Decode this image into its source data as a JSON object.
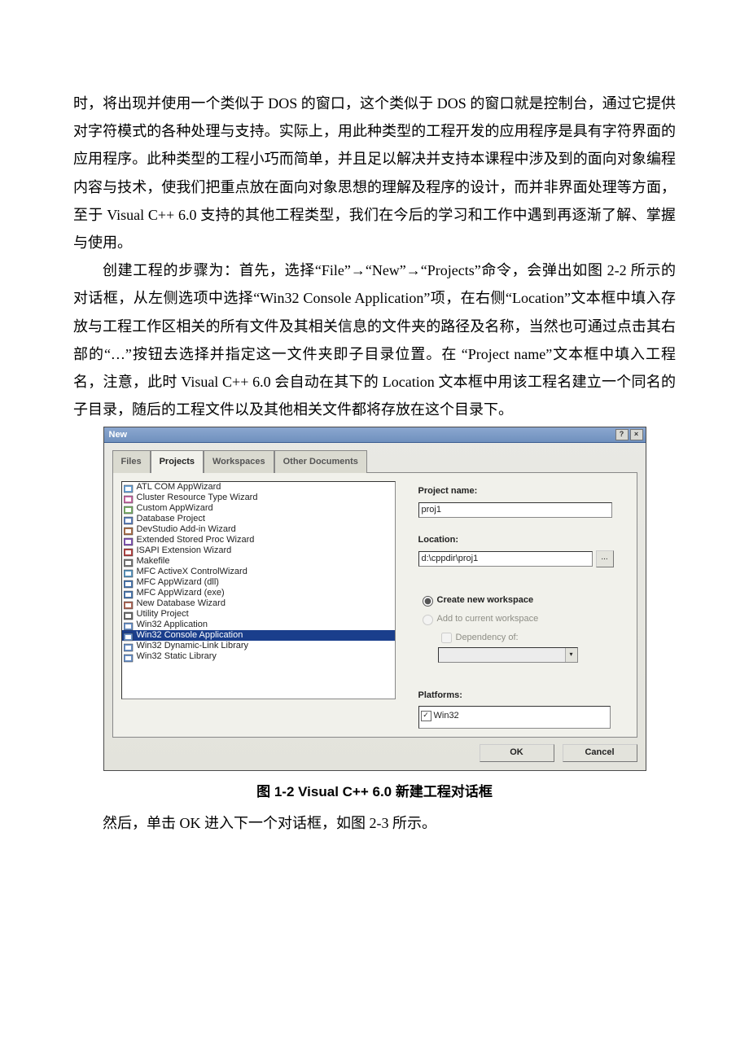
{
  "body": {
    "p1": "时，将出现并使用一个类似于 DOS 的窗口，这个类似于 DOS 的窗口就是控制台，通过它提供对字符模式的各种处理与支持。实际上，用此种类型的工程开发的应用程序是具有字符界面的应用程序。此种类型的工程小巧而简单，并且足以解决并支持本课程中涉及到的面向对象编程内容与技术，使我们把重点放在面向对象思想的理解及程序的设计，而并非界面处理等方面，至于 Visual C++ 6.0 支持的其他工程类型，我们在今后的学习和工作中遇到再逐渐了解、掌握与使用。",
    "p2": "创建工程的步骤为：首先，选择“File”→“New”→“Projects”命令，会弹出如图 2-2 所示的对话框，从左侧选项中选择“Win32 Console Application”项，在右侧“Location”文本框中填入存放与工程工作区相关的所有文件及其相关信息的文件夹的路径及名称，当然也可通过点击其右部的“…”按钮去选择并指定这一文件夹即子目录位置。在 “Project name”文本框中填入工程名，注意，此时 Visual C++ 6.0 会自动在其下的 Location 文本框中用该工程名建立一个同名的子目录，随后的工程文件以及其他相关文件都将存放在这个目录下。",
    "p3": "然后，单击 OK 进入下一个对话框，如图 2-3 所示。"
  },
  "dialog": {
    "title": "New",
    "help_btn": "?",
    "close_btn": "×",
    "tabs": {
      "files": "Files",
      "projects": "Projects",
      "workspaces": "Workspaces",
      "other": "Other Documents"
    },
    "project_types": [
      "ATL COM AppWizard",
      "Cluster Resource Type Wizard",
      "Custom AppWizard",
      "Database Project",
      "DevStudio Add-in Wizard",
      "Extended Stored Proc Wizard",
      "ISAPI Extension Wizard",
      "Makefile",
      "MFC ActiveX ControlWizard",
      "MFC AppWizard (dll)",
      "MFC AppWizard (exe)",
      "New Database Wizard",
      "Utility Project",
      "Win32 Application",
      "Win32 Console Application",
      "Win32 Dynamic-Link Library",
      "Win32 Static Library"
    ],
    "selected_index": 14,
    "labels": {
      "project_name": "Project name:",
      "location": "Location:",
      "create_new": "Create new workspace",
      "add_to_current": "Add to current workspace",
      "dependency_of": "Dependency of:",
      "platforms": "Platforms:"
    },
    "values": {
      "project_name": "proj1",
      "location": "d:\\cppdir\\proj1",
      "browse": "...",
      "platform_item": "Win32"
    },
    "buttons": {
      "ok": "OK",
      "cancel": "Cancel"
    }
  },
  "caption": "图 1-2  Visual C++ 6.0 新建工程对话框",
  "icon_colors": [
    "#6aa3d8",
    "#c96aa6",
    "#7bb06a",
    "#5c7fbb",
    "#aa6f4a",
    "#8254b5",
    "#b34242",
    "#777777",
    "#5a97c1",
    "#4b77b0",
    "#4b77b0",
    "#b06858",
    "#6a6a6a",
    "#6b92c9",
    "#6b92c9",
    "#6b92c9",
    "#6b92c9"
  ]
}
